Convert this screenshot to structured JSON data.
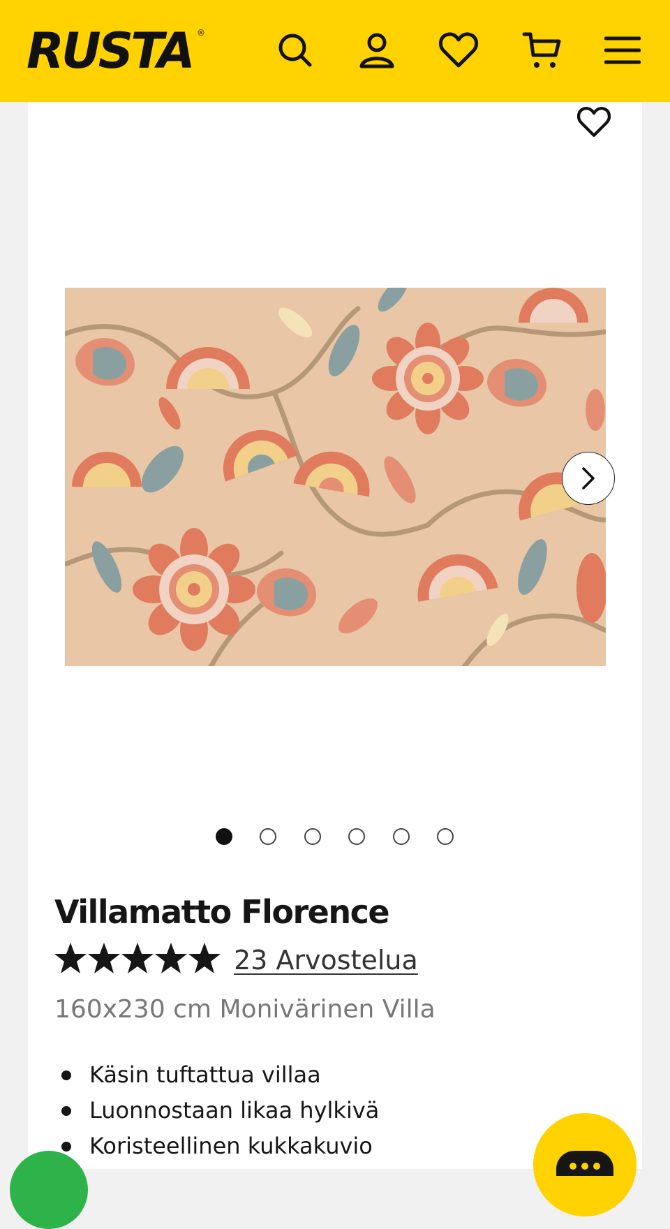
{
  "header": {
    "logo_text": "RUSTA",
    "logo_mark": "®",
    "icons": [
      "search-icon",
      "account-icon",
      "heart-icon",
      "cart-icon",
      "menu-icon"
    ],
    "background_color": "#ffd200"
  },
  "product": {
    "title": "Villamatto Florence",
    "rating": {
      "stars": 5,
      "max": 5,
      "reviews_label": "23 Arvostelua"
    },
    "subtitle": "160x230 cm Monivärinen Villa",
    "features": [
      "Käsin tuftattua villaa",
      "Luonnostaan likaa hylkivä",
      "Koristeellinen kukkakuvio"
    ]
  },
  "gallery": {
    "image_count": 6,
    "active_index": 0,
    "next_icon": "chevron-right-icon",
    "favorite_icon": "heart-outline-icon"
  },
  "floating": {
    "chat_icon": "chat-bubble-icon",
    "chat_color": "#ffd200",
    "support_color": "#2db34a"
  }
}
